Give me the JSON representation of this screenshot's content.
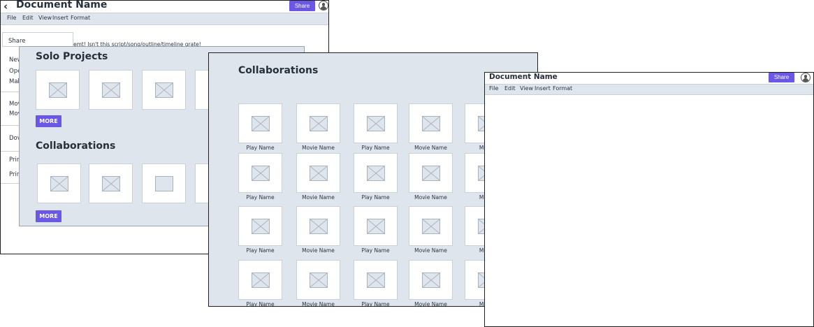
{
  "editor": {
    "back_icon": "chevron-left-icon",
    "doc_title": "Document Name",
    "share_label": "Share",
    "avatar_icon": "user-avatar-icon",
    "menu": [
      "File",
      "Edit",
      "View",
      "Insert",
      "Format"
    ],
    "body_text": "emt! Isn't this script/song/outline/timeline grate!"
  },
  "file_menu": {
    "items": [
      "Share",
      "New",
      "Ope",
      "Mak",
      "Mov",
      "Mov",
      "Dov",
      "Prir",
      "Prir"
    ]
  },
  "projects_panel": {
    "solo_heading": "Solo Projects",
    "collab_heading": "Collaborations",
    "more_label": "MORE",
    "placeholder_icon": "image-placeholder-icon"
  },
  "collaborations_page": {
    "heading": "Collaborations",
    "rows": [
      [
        "Play Name",
        "Movie Name",
        "Play Name",
        "Movie Name",
        "Music"
      ],
      [
        "Play Name",
        "Movie Name",
        "Play Name",
        "Movie Name",
        "Music"
      ],
      [
        "Play Name",
        "Movie Name",
        "Play Name",
        "Movie Name",
        "Music"
      ],
      [
        "Play Name",
        "Movie Name",
        "Play Name",
        "Movie Name",
        "Music"
      ]
    ]
  },
  "blank_editor": {
    "doc_title": "Document Name",
    "share_label": "Share",
    "menu": [
      "File",
      "Edit",
      "View",
      "Insert",
      "Format"
    ]
  },
  "colors": {
    "accent": "#6a57e6",
    "panel_bg": "#dfe5ec",
    "placeholder_border": "#a8b3bf"
  }
}
